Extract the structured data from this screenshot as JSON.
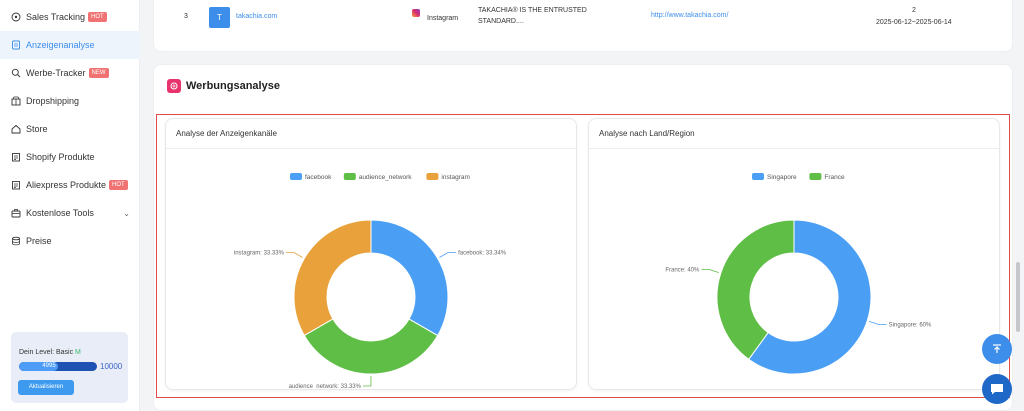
{
  "sidebar": {
    "items": [
      {
        "label": "Sales Tracking",
        "badge": "HOT",
        "icon": "target-icon",
        "active": false
      },
      {
        "label": "Anzeigenanalyse",
        "badge": "",
        "icon": "document-icon",
        "active": true
      },
      {
        "label": "Werbe-Tracker",
        "badge": "NEW",
        "icon": "search-icon",
        "active": false
      },
      {
        "label": "Dropshipping",
        "badge": "",
        "icon": "box-icon",
        "active": false
      },
      {
        "label": "Store",
        "badge": "",
        "icon": "home-icon",
        "active": false
      },
      {
        "label": "Shopify Produkte",
        "badge": "",
        "icon": "clipboard-icon",
        "active": false
      },
      {
        "label": "Aliexpress Produkte",
        "badge": "HOT",
        "icon": "clipboard-icon",
        "active": false
      },
      {
        "label": "Kostenlose Tools",
        "badge": "",
        "icon": "toolbox-icon",
        "active": false
      },
      {
        "label": "Preise",
        "badge": "",
        "icon": "database-icon",
        "active": false
      }
    ],
    "level": {
      "label": "Dein Level: Basic",
      "tier": "M",
      "current": "4995",
      "max": "10000",
      "progress": 0.4995,
      "button": "Aktualisieren"
    }
  },
  "table_row": {
    "index": "3",
    "avatar": "T",
    "domain": "takachia.com",
    "platform": "Instagram",
    "text_line1": "TAKACHIA® IS THE ENTRUSTED",
    "text_line2": "STANDARD....",
    "url": "http://www.takachia.com/",
    "count": "2",
    "date_range": "2025-06-12~2025-06-14"
  },
  "ad_section": {
    "title": "Werbungsanalyse"
  },
  "charts": {
    "channels": {
      "title": "Analyse der Anzeigenkanäle"
    },
    "regions": {
      "title": "Analyse nach Land/Region"
    }
  },
  "colors": {
    "blue": "#4a9ff5",
    "green": "#5fbe45",
    "orange": "#e9a23b",
    "accent": "#3d8eea",
    "brand_pink": "#e8336d"
  },
  "chart_data": [
    {
      "type": "pie",
      "title": "Analyse der Anzeigenkanäle",
      "categories": [
        "facebook",
        "audience_network",
        "instagram"
      ],
      "values": [
        33.34,
        33.33,
        33.33
      ],
      "labels": [
        "facebook: 33.34%",
        "audience_network: 33.33%",
        "instagram: 33.33%"
      ],
      "colors": [
        "#4a9ff5",
        "#5fbe45",
        "#e9a23b"
      ],
      "legend": "top"
    },
    {
      "type": "pie",
      "title": "Analyse nach Land/Region",
      "categories": [
        "Singapore",
        "France"
      ],
      "values": [
        60,
        40
      ],
      "labels": [
        "Singapore: 60%",
        "France: 40%"
      ],
      "colors": [
        "#4a9ff5",
        "#5fbe45"
      ],
      "legend": "top"
    }
  ]
}
